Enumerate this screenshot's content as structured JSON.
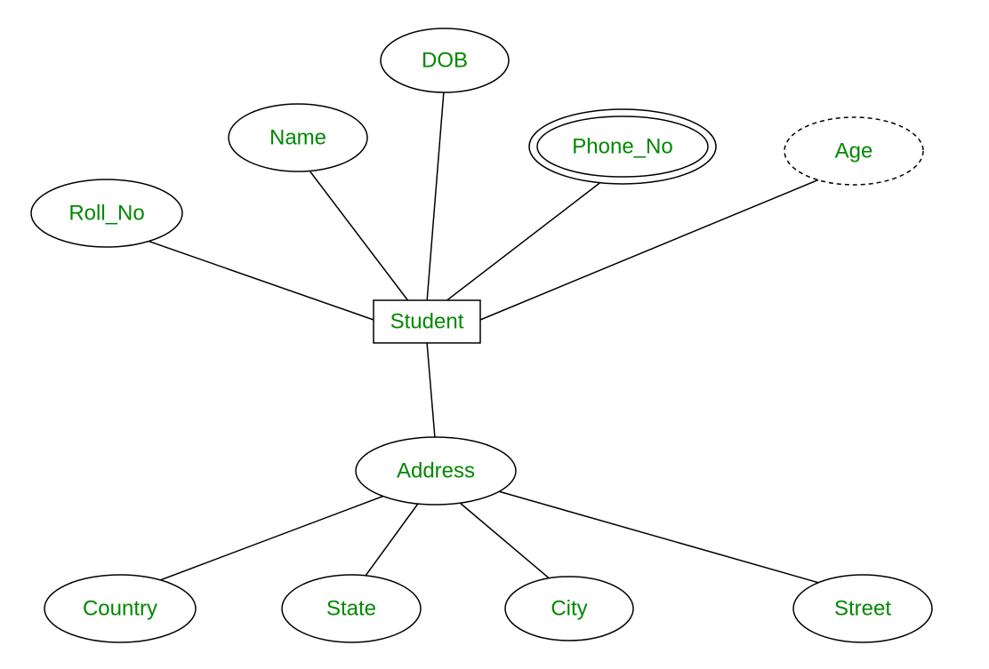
{
  "diagram": {
    "entity": "Student",
    "attributes": {
      "roll_no": "Roll_No",
      "name": "Name",
      "dob": "DOB",
      "phone_no": "Phone_No",
      "age": "Age",
      "address": "Address"
    },
    "address_subattrs": {
      "country": "Country",
      "state": "State",
      "city": "City",
      "street": "Street"
    }
  }
}
